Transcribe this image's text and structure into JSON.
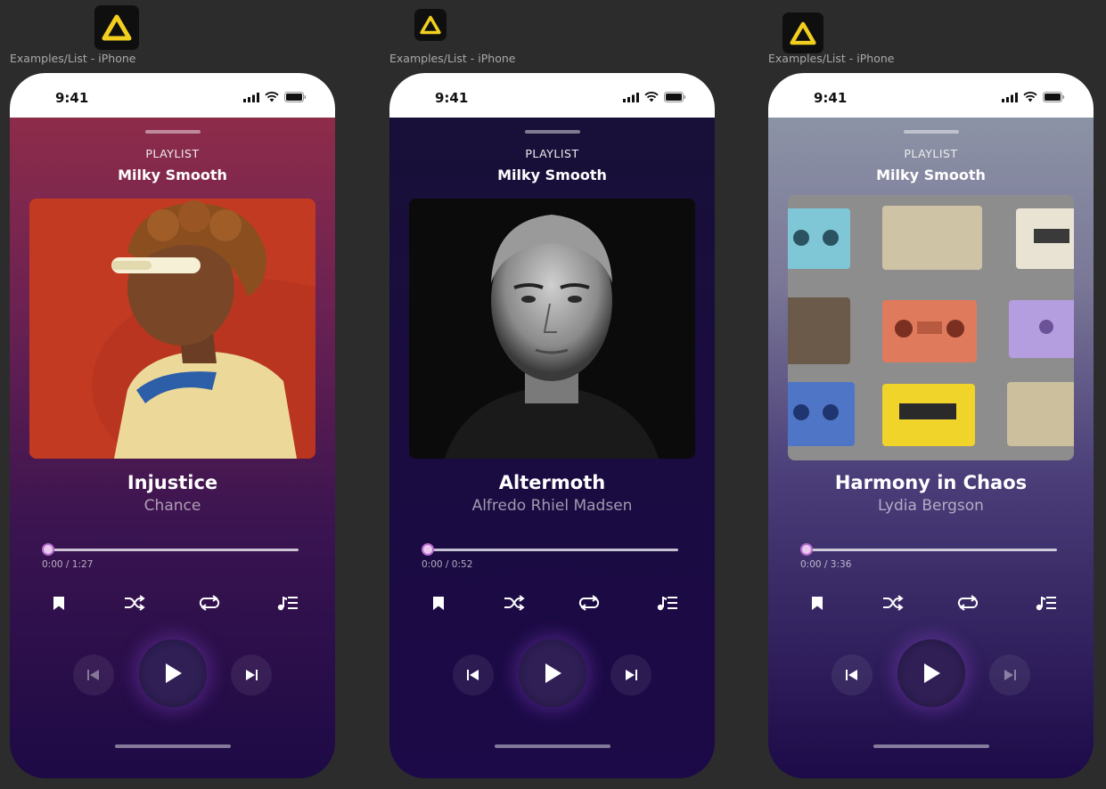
{
  "frames": [
    {
      "caption": "Examples/List - iPhone",
      "status_time": "9:41",
      "playlist_label": "PLAYLIST",
      "playlist_name": "Milky Smooth",
      "song_title": "Injustice",
      "artist": "Chance",
      "time_progress": "0:00 / 1:27",
      "progress": 0,
      "gradient": [
        "#8e2c4a",
        "#3a1450",
        "#1d0a45"
      ],
      "art_subject": "person-with-sunglasses-photo"
    },
    {
      "caption": "Examples/List - iPhone",
      "status_time": "9:41",
      "playlist_label": "PLAYLIST",
      "playlist_name": "Milky Smooth",
      "song_title": "Altermoth",
      "artist": "Alfredo Rhiel Madsen",
      "time_progress": "0:00 / 0:52",
      "progress": 0,
      "gradient": [
        "#181038",
        "#1a0a42",
        "#1c0a48"
      ],
      "art_subject": "man-portrait-bw-photo"
    },
    {
      "caption": "Examples/List - iPhone",
      "status_time": "9:41",
      "playlist_label": "PLAYLIST",
      "playlist_name": "Milky Smooth",
      "song_title": "Harmony in Chaos",
      "artist": "Lydia Bergson",
      "time_progress": "0:00 / 3:36",
      "progress": 0,
      "gradient": [
        "#8c93a6",
        "#4a3d78",
        "#1d0a48"
      ],
      "art_subject": "cassette-tapes-photo"
    }
  ],
  "colors": {
    "canvas": "#2c2c2c",
    "app_icon_yellow": "#f2cf1e",
    "knob": "#e9c9ee",
    "play_button": "#2f1f55"
  },
  "icons": {
    "app": "triangle-logo-icon",
    "signal": "cellular-signal-icon",
    "wifi": "wifi-icon",
    "battery": "battery-icon",
    "bookmark": "bookmark-icon",
    "shuffle": "shuffle-icon",
    "repeat": "repeat-icon",
    "queue": "music-queue-icon",
    "previous": "skip-previous-icon",
    "play": "play-icon",
    "next": "skip-next-icon"
  }
}
